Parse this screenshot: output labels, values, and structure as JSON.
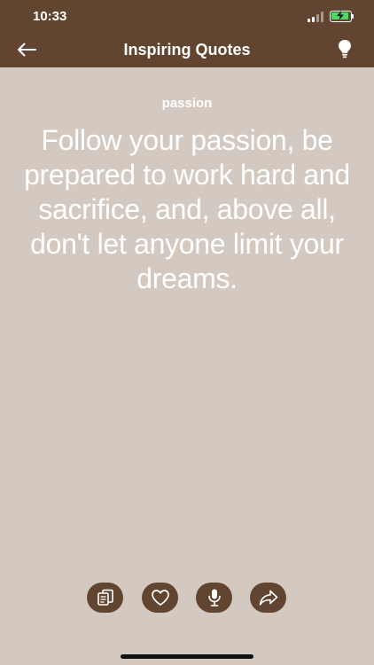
{
  "status": {
    "time": "10:33"
  },
  "nav": {
    "title": "Inspiring Quotes"
  },
  "quote": {
    "category": "passion",
    "text": "Follow your passion, be prepared to work hard and sacrifice, and, above all, don't let anyone limit your dreams."
  },
  "actions": [
    {
      "icon": "copy-icon"
    },
    {
      "icon": "heart-icon"
    },
    {
      "icon": "microphone-icon"
    },
    {
      "icon": "share-icon"
    }
  ],
  "colors": {
    "header": "#624530",
    "background": "#d3c9c0",
    "text": "#ffffff",
    "battery": "#4cd964"
  }
}
